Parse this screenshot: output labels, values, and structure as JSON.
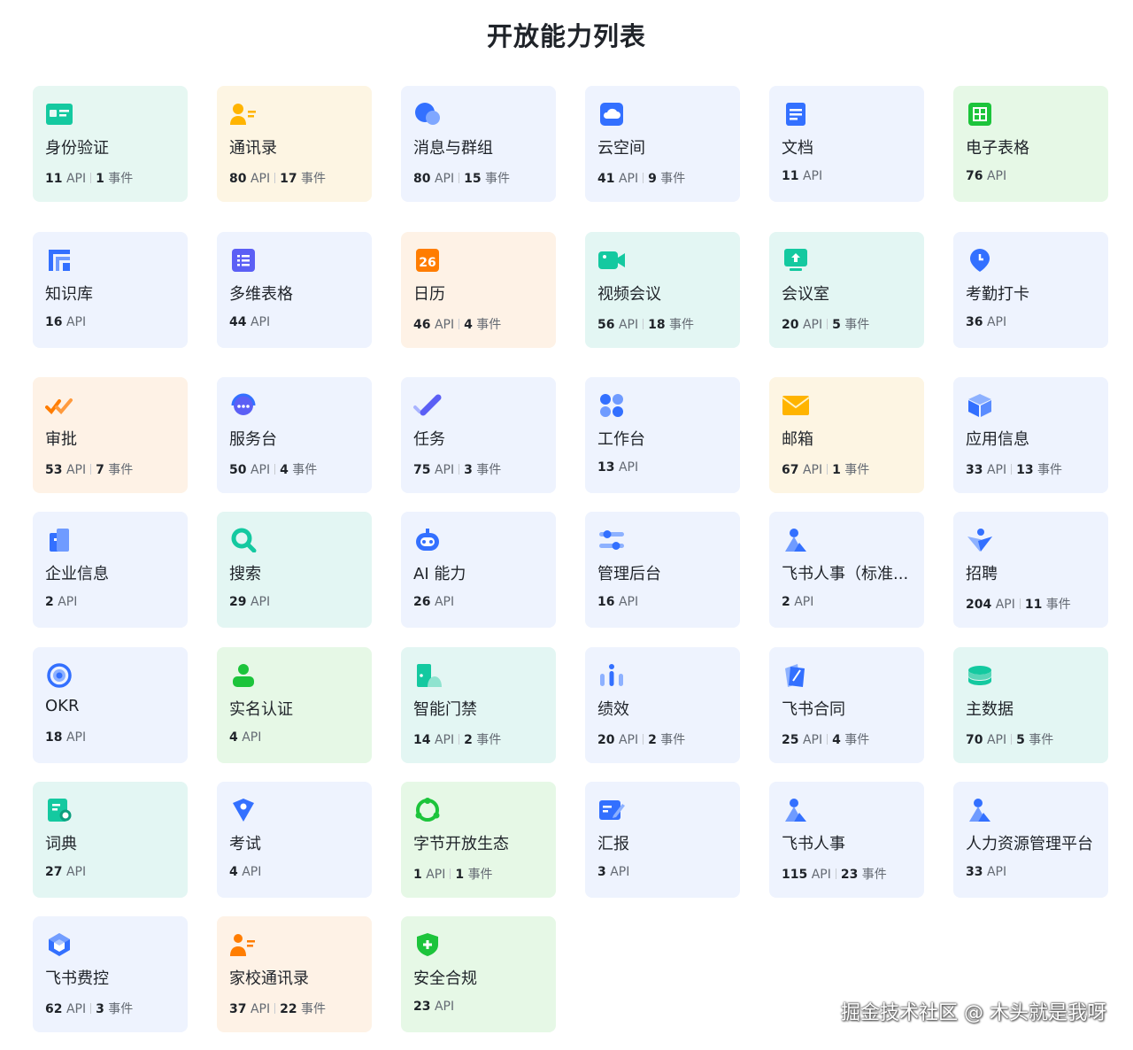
{
  "title": "开放能力列表",
  "watermark": "掘金技术社区 @ 木头就是我呀",
  "units": {
    "api": "API",
    "event": "事件"
  },
  "cards": [
    {
      "name": "身份验证",
      "api": "11",
      "events": "1",
      "icon": "id-card-icon",
      "bg": "bg-teal",
      "color": "#14c9a0"
    },
    {
      "name": "通讯录",
      "api": "80",
      "events": "17",
      "icon": "contacts-icon",
      "bg": "bg-yellow",
      "color": "#ffb400"
    },
    {
      "name": "消息与群组",
      "api": "80",
      "events": "15",
      "icon": "chat-bubble-icon",
      "bg": "bg-blue",
      "color": "#3370ff"
    },
    {
      "name": "云空间",
      "api": "41",
      "events": "9",
      "icon": "cloud-drive-icon",
      "bg": "bg-blue",
      "color": "#3370ff"
    },
    {
      "name": "文档",
      "api": "11",
      "events": null,
      "icon": "document-icon",
      "bg": "bg-blue",
      "color": "#3370ff"
    },
    {
      "name": "电子表格",
      "api": "76",
      "events": null,
      "icon": "spreadsheet-icon",
      "bg": "bg-green",
      "color": "#1cc43b"
    },
    {
      "name": "知识库",
      "api": "16",
      "events": null,
      "icon": "wiki-icon",
      "bg": "bg-blue",
      "color": "#3370ff"
    },
    {
      "name": "多维表格",
      "api": "44",
      "events": null,
      "icon": "bitable-icon",
      "bg": "bg-blue",
      "color": "#5b5ff5"
    },
    {
      "name": "日历",
      "api": "46",
      "events": "4",
      "icon": "calendar-icon",
      "bg": "bg-orange",
      "color": "#ff7d00"
    },
    {
      "name": "视频会议",
      "api": "56",
      "events": "18",
      "icon": "video-camera-icon",
      "bg": "bg-mint",
      "color": "#14c9a0"
    },
    {
      "name": "会议室",
      "api": "20",
      "events": "5",
      "icon": "meeting-room-icon",
      "bg": "bg-mint",
      "color": "#14c9a0"
    },
    {
      "name": "考勤打卡",
      "api": "36",
      "events": null,
      "icon": "location-pin-icon",
      "bg": "bg-blue",
      "color": "#3370ff"
    },
    {
      "name": "审批",
      "api": "53",
      "events": "7",
      "icon": "approval-check-icon",
      "bg": "bg-orange",
      "color": "#ff7d00"
    },
    {
      "name": "服务台",
      "api": "50",
      "events": "4",
      "icon": "helpdesk-icon",
      "bg": "bg-blue",
      "color": "#5b5ff5"
    },
    {
      "name": "任务",
      "api": "75",
      "events": "3",
      "icon": "task-icon",
      "bg": "bg-blue",
      "color": "#5b5ff5"
    },
    {
      "name": "工作台",
      "api": "13",
      "events": null,
      "icon": "workplace-icon",
      "bg": "bg-blue",
      "color": "#3370ff"
    },
    {
      "name": "邮箱",
      "api": "67",
      "events": "1",
      "icon": "mail-icon",
      "bg": "bg-yellow",
      "color": "#ffb400"
    },
    {
      "name": "应用信息",
      "api": "33",
      "events": "13",
      "icon": "app-cube-icon",
      "bg": "bg-blue",
      "color": "#3370ff"
    },
    {
      "name": "企业信息",
      "api": "2",
      "events": null,
      "icon": "company-icon",
      "bg": "bg-blue",
      "color": "#3370ff"
    },
    {
      "name": "搜索",
      "api": "29",
      "events": null,
      "icon": "search-icon",
      "bg": "bg-mint",
      "color": "#14c9a0"
    },
    {
      "name": "AI 能力",
      "api": "26",
      "events": null,
      "icon": "robot-icon",
      "bg": "bg-blue",
      "color": "#3370ff"
    },
    {
      "name": "管理后台",
      "api": "16",
      "events": null,
      "icon": "admin-sliders-icon",
      "bg": "bg-blue",
      "color": "#3370ff"
    },
    {
      "name": "飞书人事（标准...",
      "api": "2",
      "events": null,
      "icon": "people-icon",
      "bg": "bg-blue",
      "color": "#3370ff"
    },
    {
      "name": "招聘",
      "api": "204",
      "events": "11",
      "icon": "recruit-icon",
      "bg": "bg-blue",
      "color": "#3370ff"
    },
    {
      "name": "OKR",
      "api": "18",
      "events": null,
      "icon": "okr-target-icon",
      "bg": "bg-blue",
      "color": "#3370ff"
    },
    {
      "name": "实名认证",
      "api": "4",
      "events": null,
      "icon": "person-verify-icon",
      "bg": "bg-green",
      "color": "#1cc43b"
    },
    {
      "name": "智能门禁",
      "api": "14",
      "events": "2",
      "icon": "door-access-icon",
      "bg": "bg-mint",
      "color": "#14c9a0"
    },
    {
      "name": "绩效",
      "api": "20",
      "events": "2",
      "icon": "performance-icon",
      "bg": "bg-blue",
      "color": "#3370ff"
    },
    {
      "name": "飞书合同",
      "api": "25",
      "events": "4",
      "icon": "contract-icon",
      "bg": "bg-blue",
      "color": "#3370ff"
    },
    {
      "name": "主数据",
      "api": "70",
      "events": "5",
      "icon": "database-icon",
      "bg": "bg-mint",
      "color": "#14c9a0"
    },
    {
      "name": "词典",
      "api": "27",
      "events": null,
      "icon": "dictionary-icon",
      "bg": "bg-mint",
      "color": "#14c9a0"
    },
    {
      "name": "考试",
      "api": "4",
      "events": null,
      "icon": "exam-pen-icon",
      "bg": "bg-blue",
      "color": "#3370ff"
    },
    {
      "name": "字节开放生态",
      "api": "1",
      "events": "1",
      "icon": "ecosystem-icon",
      "bg": "bg-green",
      "color": "#1cc43b"
    },
    {
      "name": "汇报",
      "api": "3",
      "events": null,
      "icon": "report-icon",
      "bg": "bg-blue",
      "color": "#3370ff"
    },
    {
      "name": "飞书人事",
      "api": "115",
      "events": "23",
      "icon": "people-icon",
      "bg": "bg-blue",
      "color": "#3370ff"
    },
    {
      "name": "人力资源管理平台",
      "api": "33",
      "events": null,
      "icon": "people-icon",
      "bg": "bg-blue",
      "color": "#3370ff"
    },
    {
      "name": "飞书费控",
      "api": "62",
      "events": "3",
      "icon": "expense-hex-icon",
      "bg": "bg-blue",
      "color": "#3370ff"
    },
    {
      "name": "家校通讯录",
      "api": "37",
      "events": "22",
      "icon": "school-contacts-icon",
      "bg": "bg-orange",
      "color": "#ff7d00"
    },
    {
      "name": "安全合规",
      "api": "23",
      "events": null,
      "icon": "security-shield-icon",
      "bg": "bg-green",
      "color": "#1cc43b"
    }
  ]
}
